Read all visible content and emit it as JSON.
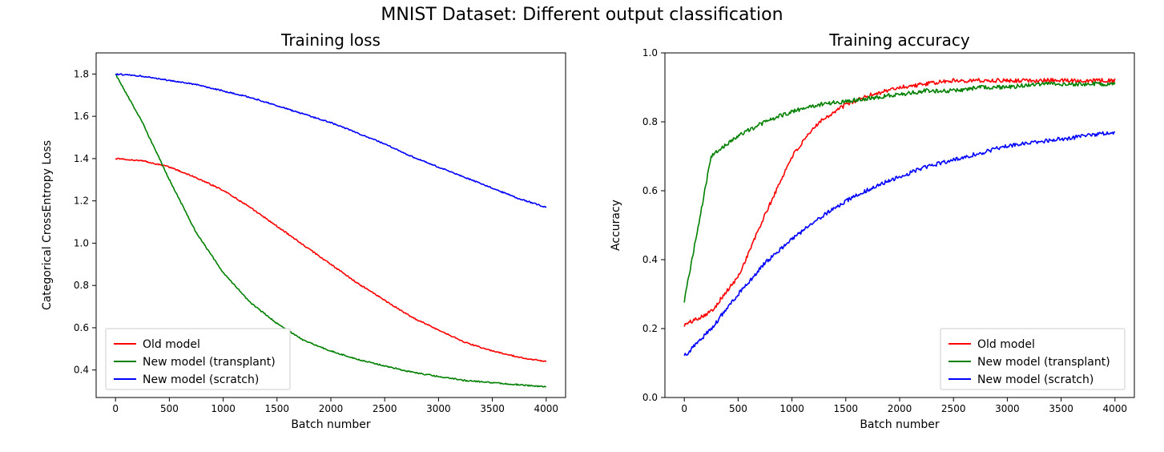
{
  "suptitle": "MNIST Dataset: Different output classification",
  "chart_data": [
    {
      "type": "line",
      "title": "Training loss",
      "xlabel": "Batch number",
      "ylabel": "Categorical CrossEntropy Loss",
      "xlim": [
        -180,
        4180
      ],
      "ylim": [
        0.27,
        1.9
      ],
      "xticks": [
        0,
        500,
        1000,
        1500,
        2000,
        2500,
        3000,
        3500,
        4000
      ],
      "yticks": [
        0.4,
        0.6,
        0.8,
        1.0,
        1.2,
        1.4,
        1.6,
        1.8
      ],
      "legend_pos": "lower-left",
      "x": [
        0,
        250,
        500,
        750,
        1000,
        1250,
        1500,
        1750,
        2000,
        2250,
        2500,
        2750,
        3000,
        3250,
        3500,
        3750,
        4000
      ],
      "series": [
        {
          "name": "Old model",
          "color": "#ff0000",
          "values": [
            1.4,
            1.39,
            1.36,
            1.31,
            1.25,
            1.17,
            1.08,
            0.99,
            0.9,
            0.81,
            0.73,
            0.65,
            0.59,
            0.53,
            0.49,
            0.46,
            0.44
          ]
        },
        {
          "name": "New model (transplant)",
          "color": "#008000",
          "values": [
            1.8,
            1.57,
            1.3,
            1.05,
            0.86,
            0.72,
            0.62,
            0.54,
            0.49,
            0.45,
            0.42,
            0.39,
            0.37,
            0.35,
            0.34,
            0.33,
            0.32
          ]
        },
        {
          "name": "New model (scratch)",
          "color": "#0000ff",
          "values": [
            1.8,
            1.79,
            1.77,
            1.75,
            1.72,
            1.69,
            1.65,
            1.61,
            1.57,
            1.52,
            1.47,
            1.41,
            1.36,
            1.31,
            1.26,
            1.21,
            1.17
          ]
        }
      ]
    },
    {
      "type": "line",
      "title": "Training accuracy",
      "xlabel": "Batch number",
      "ylabel": "Accuracy",
      "xlim": [
        -180,
        4180
      ],
      "ylim": [
        0.0,
        1.0
      ],
      "xticks": [
        0,
        500,
        1000,
        1500,
        2000,
        2500,
        3000,
        3500,
        4000
      ],
      "yticks": [
        0.0,
        0.2,
        0.4,
        0.6,
        0.8,
        1.0
      ],
      "legend_pos": "lower-right",
      "x": [
        0,
        250,
        500,
        750,
        1000,
        1250,
        1500,
        1750,
        2000,
        2250,
        2500,
        2750,
        3000,
        3250,
        3500,
        3750,
        4000
      ],
      "series": [
        {
          "name": "Old model",
          "color": "#ff0000",
          "values": [
            0.21,
            0.25,
            0.35,
            0.53,
            0.7,
            0.8,
            0.85,
            0.88,
            0.9,
            0.91,
            0.92,
            0.92,
            0.92,
            0.92,
            0.92,
            0.92,
            0.92
          ]
        },
        {
          "name": "New model (transplant)",
          "color": "#008000",
          "values": [
            0.28,
            0.7,
            0.76,
            0.8,
            0.83,
            0.85,
            0.86,
            0.87,
            0.88,
            0.89,
            0.89,
            0.9,
            0.9,
            0.91,
            0.91,
            0.91,
            0.91
          ]
        },
        {
          "name": "New model (scratch)",
          "color": "#0000ff",
          "values": [
            0.12,
            0.2,
            0.3,
            0.39,
            0.46,
            0.52,
            0.57,
            0.61,
            0.64,
            0.67,
            0.69,
            0.71,
            0.73,
            0.74,
            0.75,
            0.76,
            0.77
          ]
        }
      ]
    }
  ],
  "legend_labels": {
    "old": "Old model",
    "transplant": "New model (transplant)",
    "scratch": "New model (scratch)"
  }
}
